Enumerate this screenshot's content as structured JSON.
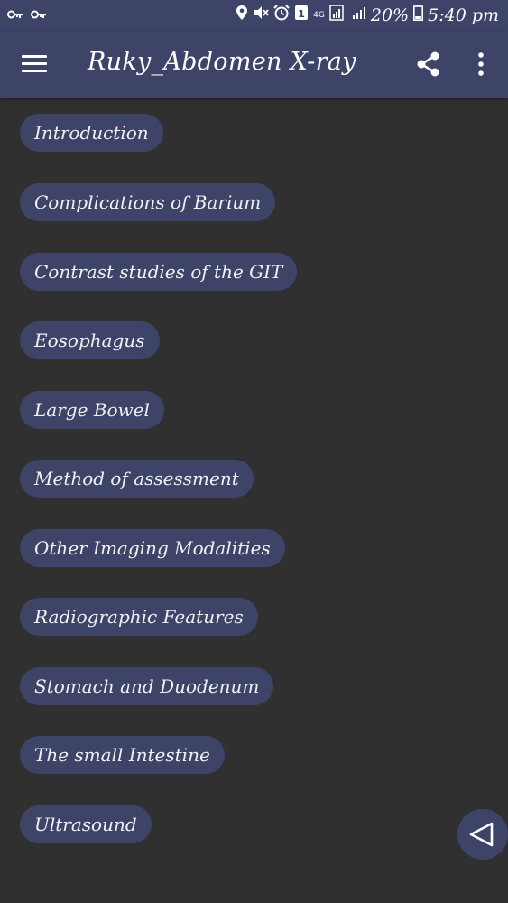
{
  "status_bar": {
    "left_icons": [
      "key-icon",
      "key-icon"
    ],
    "network_label": "4G",
    "battery_percent": "20%",
    "time": "5:40 pm",
    "icons": [
      "location-icon",
      "mute-icon",
      "alarm-icon",
      "sim-icon",
      "signal-icon",
      "battery-icon"
    ]
  },
  "app_bar": {
    "title": "Ruky_Abdomen X-ray",
    "icons": [
      "menu-icon",
      "share-icon",
      "more-vert-icon"
    ]
  },
  "topics": [
    "Introduction",
    "Complications of Barium",
    "Contrast studies of the GIT",
    "Eosophagus",
    "Large Bowel",
    "Method of assessment",
    "Other Imaging Modalities",
    "Radiographic Features",
    "Stomach and Duodenum",
    "The small Intestine",
    "Ultrasound"
  ],
  "fab": {
    "icon": "back-triangle-icon"
  },
  "colors": {
    "background": "#303030",
    "bar": "#3d4468",
    "chip": "#3d4468",
    "text": "#ffffff"
  }
}
